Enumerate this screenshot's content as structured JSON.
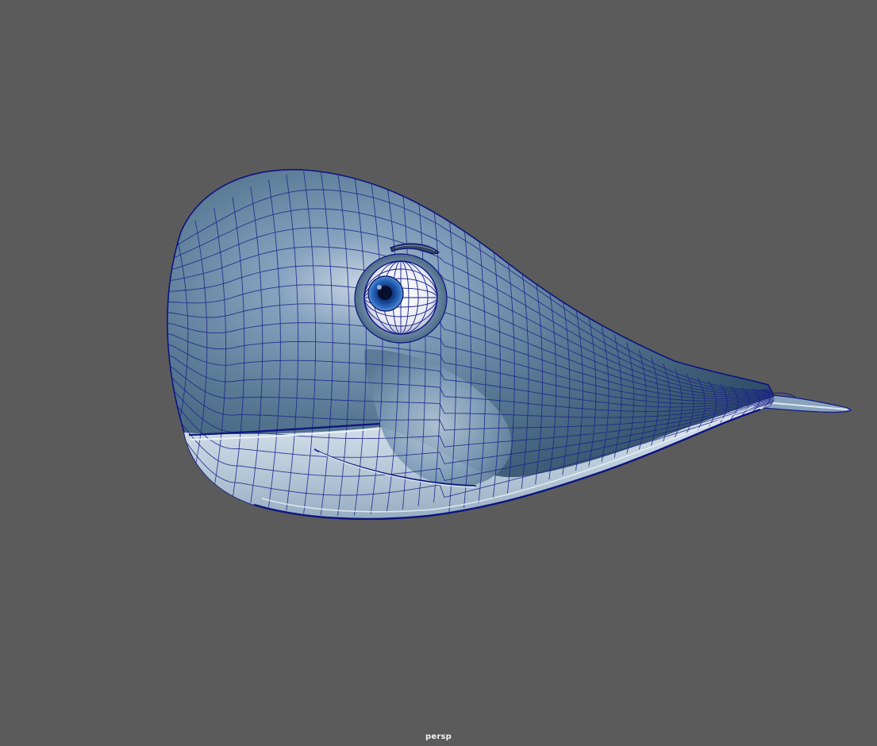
{
  "viewport": {
    "camera_label": "persp",
    "background_color": "#5b5b5b",
    "wireframe_color": "#1a2288",
    "model": "whale-model"
  }
}
